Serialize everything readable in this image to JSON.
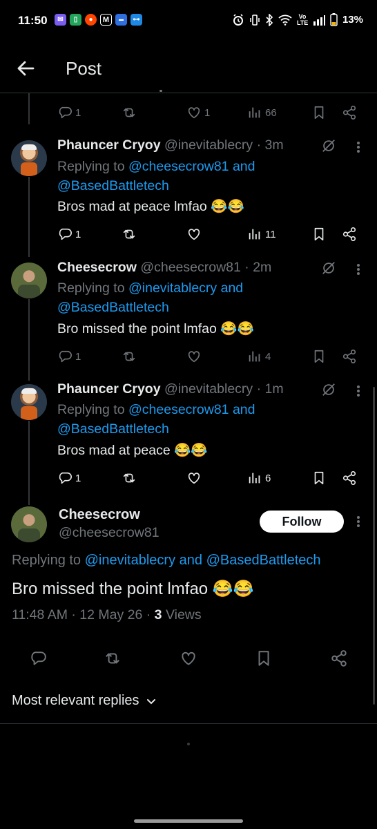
{
  "status_bar": {
    "time": "11:50",
    "battery": "13%",
    "network_label": "Vo LTE"
  },
  "header": {
    "title": "Post"
  },
  "top_actions": {
    "replies": "1",
    "likes": "1",
    "views": "66"
  },
  "replies": [
    {
      "name": "Phauncer Cryoy",
      "handle": "@inevitablecry",
      "time": "· 3m",
      "replying_prefix": "Replying to",
      "mention1": "@cheesecrow81",
      "and": "and",
      "mention2": "@BasedBattletech",
      "text": "Bros mad at peace lmfao 😂😂",
      "reply_count": "1",
      "views": "11"
    },
    {
      "name": "Cheesecrow",
      "handle": "@cheesecrow81",
      "time": "· 2m",
      "replying_prefix": "Replying to",
      "mention1": "@inevitablecry",
      "and": "and",
      "mention2": "@BasedBattletech",
      "text": "Bro missed the point lmfao 😂😂",
      "reply_count": "1",
      "views": "4"
    },
    {
      "name": "Phauncer Cryoy",
      "handle": "@inevitablecry",
      "time": "· 1m",
      "replying_prefix": "Replying to",
      "mention1": "@cheesecrow81",
      "and": "and",
      "mention2": "@BasedBattletech",
      "text": "Bros mad at peace 😂😂",
      "reply_count": "1",
      "views": "6"
    }
  ],
  "main_tweet": {
    "name": "Cheesecrow",
    "handle": "@cheesecrow81",
    "follow_label": "Follow",
    "replying_prefix": "Replying to",
    "mention1": "@inevitablecry",
    "and": "and",
    "mention2": "@BasedBattletech",
    "text": "Bro missed the point lmfao 😂😂",
    "timestamp": "11:48 AM · 12 May 26 ·",
    "views_count": "3",
    "views_label": "Views"
  },
  "sort": {
    "label": "Most relevant replies"
  },
  "colors": {
    "accent": "#1d9bf0",
    "muted": "#71767b",
    "background": "#000000"
  }
}
